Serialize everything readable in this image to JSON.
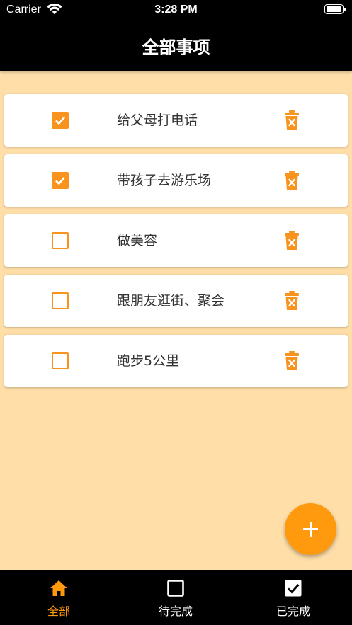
{
  "status_bar": {
    "carrier": "Carrier",
    "time": "3:28 PM"
  },
  "nav": {
    "title": "全部事项"
  },
  "todos": [
    {
      "text": "给父母打电话",
      "done": true
    },
    {
      "text": "带孩子去游乐场",
      "done": true
    },
    {
      "text": "做美容",
      "done": false
    },
    {
      "text": "跟朋友逛街、聚会",
      "done": false
    },
    {
      "text": "跑步5公里",
      "done": false
    }
  ],
  "fab": {
    "icon": "plus-icon"
  },
  "tabs": [
    {
      "label": "全部",
      "icon": "home-icon",
      "active": true
    },
    {
      "label": "待完成",
      "icon": "empty-checkbox-icon",
      "active": false
    },
    {
      "label": "已完成",
      "icon": "checked-checkbox-icon",
      "active": false
    }
  ],
  "colors": {
    "accent": "#FF9A0F",
    "checkbox": "#F7931E",
    "background": "#FFDEA8",
    "bar": "#000000",
    "card": "#FFFFFF"
  }
}
